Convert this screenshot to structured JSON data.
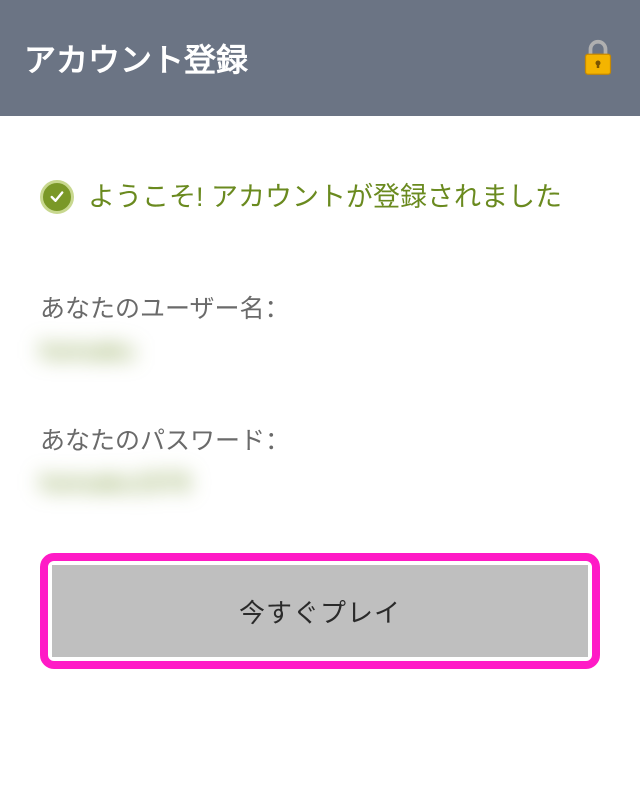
{
  "header": {
    "title": "アカウント登録"
  },
  "success": {
    "message": "ようこそ! アカウントが登録されました"
  },
  "fields": {
    "username_label": "あなたのユーザー名：",
    "username_value": "honsaku",
    "password_label": "あなたのパスワード：",
    "password_value": "honsaku1978"
  },
  "actions": {
    "play_label": "今すぐプレイ"
  },
  "icons": {
    "lock": "lock-icon",
    "check": "check-icon"
  }
}
